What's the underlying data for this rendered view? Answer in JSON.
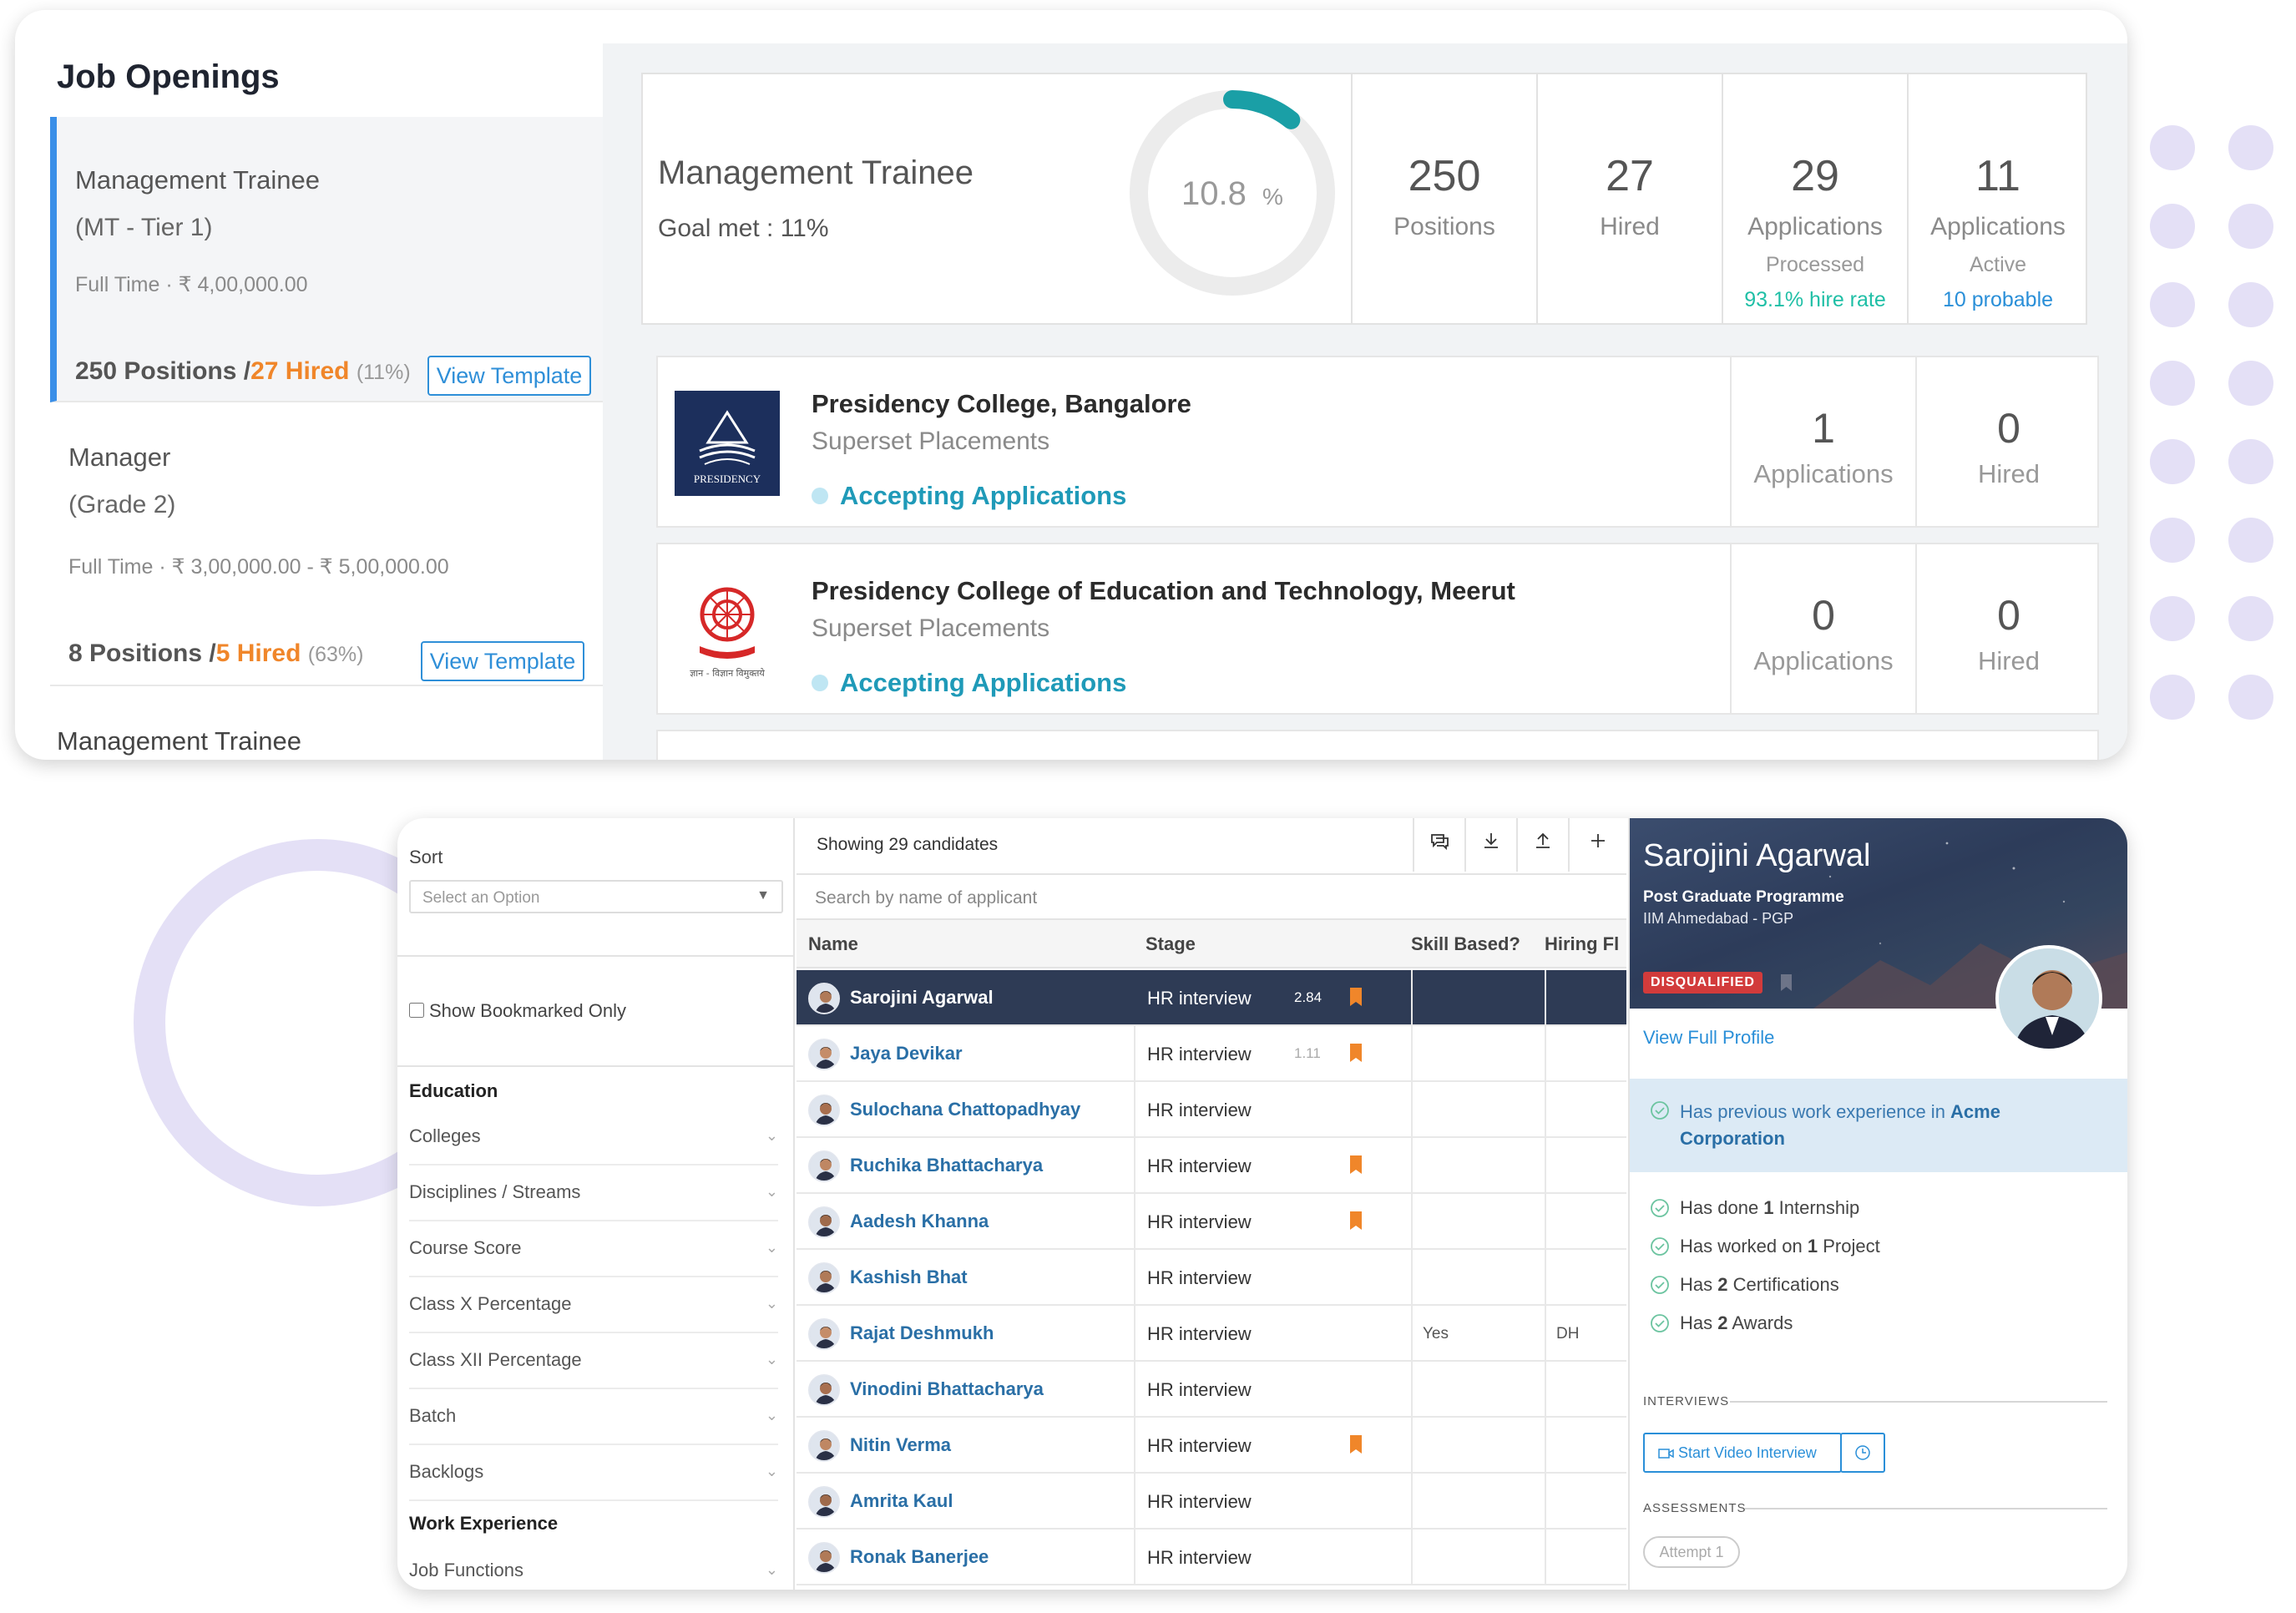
{
  "job_openings": {
    "title": "Job Openings",
    "items": [
      {
        "name": "Management Trainee",
        "grade": "(MT - Tier 1)",
        "meta": "Full Time · ₹  4,00,000.00",
        "positions": "250 Positions /",
        "hired": "27 Hired",
        "pct": "(11%)",
        "button": "View Template"
      },
      {
        "name": "Manager",
        "grade": "(Grade 2)",
        "meta": "Full Time · ₹  3,00,000.00 - ₹  5,00,000.00",
        "positions": "8 Positions /",
        "hired": "5 Hired",
        "pct": "(63%)",
        "button": "View Template"
      }
    ],
    "cut_item": "Management Trainee"
  },
  "summary": {
    "title": "Management Trainee",
    "goal": "Goal met : 11%",
    "progress_value": "10.8",
    "progress_unit": "%",
    "progress_fraction": 0.108,
    "stats": [
      {
        "num": "250",
        "label": "Positions",
        "sub": "",
        "extra": ""
      },
      {
        "num": "27",
        "label": "Hired",
        "sub": "",
        "extra": ""
      },
      {
        "num": "29",
        "label": "Applications",
        "sub": "Processed",
        "extra": "93.1% hire rate"
      },
      {
        "num": "11",
        "label": "Applications",
        "sub": "Active",
        "extra": "10 probable"
      }
    ],
    "colors": {
      "progress": "#1a9fa6",
      "hire_rate": "#1fbfa6",
      "probable": "#2a8fd8"
    }
  },
  "colleges": [
    {
      "name": "Presidency College, Bangalore",
      "sub": "Superset Placements",
      "status": "Accepting Applications",
      "applications": "1",
      "applications_label": "Applications",
      "hired": "0",
      "hired_label": "Hired",
      "logo_text": "PRESIDENCY"
    },
    {
      "name": "Presidency College of Education and Technology, Meerut",
      "sub": "Superset Placements",
      "status": "Accepting Applications",
      "applications": "0",
      "applications_label": "Applications",
      "hired": "0",
      "hired_label": "Hired",
      "logo_text": "ज्ञान - विज्ञान विमुक्तये"
    }
  ],
  "filters": {
    "sort_label": "Sort",
    "sort_placeholder": "Select an Option",
    "bookmarked": "Show Bookmarked Only",
    "education_heading": "Education",
    "education": [
      "Colleges",
      "Disciplines / Streams",
      "Course Score",
      "Class X Percentage",
      "Class XII Percentage",
      "Batch",
      "Backlogs"
    ],
    "work_heading": "Work Experience",
    "work": [
      "Job Functions"
    ]
  },
  "table": {
    "showing": "Showing 29 candidates",
    "search_placeholder": "Search by name of applicant",
    "headers": {
      "name": "Name",
      "stage": "Stage",
      "skill": "Skill Based?",
      "hiring": "Hiring Fl"
    },
    "rows": [
      {
        "name": "Sarojini Agarwal",
        "stage": "HR interview",
        "score": "2.84",
        "bookmark": true,
        "skill": "",
        "hiring": ""
      },
      {
        "name": "Jaya Devikar",
        "stage": "HR interview",
        "score": "1.11",
        "bookmark": true,
        "skill": "",
        "hiring": ""
      },
      {
        "name": "Sulochana Chattopadhyay",
        "stage": "HR interview",
        "score": "",
        "bookmark": false,
        "skill": "",
        "hiring": ""
      },
      {
        "name": "Ruchika Bhattacharya",
        "stage": "HR interview",
        "score": "",
        "bookmark": true,
        "skill": "",
        "hiring": ""
      },
      {
        "name": "Aadesh Khanna",
        "stage": "HR interview",
        "score": "",
        "bookmark": true,
        "skill": "",
        "hiring": ""
      },
      {
        "name": "Kashish Bhat",
        "stage": "HR interview",
        "score": "",
        "bookmark": false,
        "skill": "",
        "hiring": ""
      },
      {
        "name": "Rajat Deshmukh",
        "stage": "HR interview",
        "score": "",
        "bookmark": false,
        "skill": "Yes",
        "hiring": "DH"
      },
      {
        "name": "Vinodini Bhattacharya",
        "stage": "HR interview",
        "score": "",
        "bookmark": false,
        "skill": "",
        "hiring": ""
      },
      {
        "name": "Nitin Verma",
        "stage": "HR interview",
        "score": "",
        "bookmark": true,
        "skill": "",
        "hiring": ""
      },
      {
        "name": "Amrita Kaul",
        "stage": "HR interview",
        "score": "",
        "bookmark": false,
        "skill": "",
        "hiring": ""
      },
      {
        "name": "Ronak Banerjee",
        "stage": "HR interview",
        "score": "",
        "bookmark": false,
        "skill": "",
        "hiring": ""
      }
    ],
    "toolbar_icons": [
      "comment-icon",
      "download-icon",
      "upload-icon",
      "plus-icon"
    ]
  },
  "profile": {
    "name": "Sarojini Agarwal",
    "programme": "Post Graduate Programme",
    "school": "IIM Ahmedabad - PGP",
    "badge": "DISQUALIFIED",
    "view_link": "View Full Profile",
    "highlight_pre": "Has previous work experience in ",
    "highlight_bold": "Acme Corporation",
    "facts": [
      {
        "pre": "Has done ",
        "bold": "1",
        "post": " Internship"
      },
      {
        "pre": "Has worked on ",
        "bold": "1",
        "post": " Project"
      },
      {
        "pre": "Has ",
        "bold": "2",
        "post": " Certifications"
      },
      {
        "pre": "Has ",
        "bold": "2",
        "post": " Awards"
      }
    ],
    "interviews_label": "INTERVIEWS",
    "video_button": "Start Video Interview",
    "assessments_label": "ASSESSMENTS",
    "attempt": "Attempt 1"
  }
}
